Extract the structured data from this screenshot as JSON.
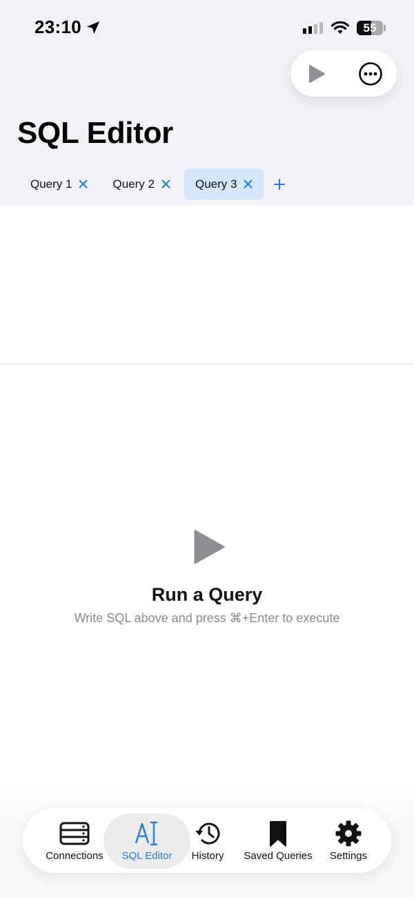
{
  "status_bar": {
    "time": "23:10",
    "battery": "55",
    "icons": [
      "location-arrow-icon",
      "cellular-signal-icon",
      "wifi-icon",
      "battery-icon"
    ]
  },
  "toolbar": {
    "run_icon": "play-icon",
    "more_icon": "ellipsis-circle-icon"
  },
  "header": {
    "title": "SQL Editor"
  },
  "tabs": [
    {
      "label": "Query 1",
      "active": false
    },
    {
      "label": "Query 2",
      "active": false
    },
    {
      "label": "Query 3",
      "active": true
    }
  ],
  "add_tab_icon": "plus-icon",
  "empty_state": {
    "icon": "play-icon",
    "title": "Run a Query",
    "subtitle": "Write SQL above and press ⌘+Enter to execute"
  },
  "tab_bar": {
    "items": [
      {
        "label": "Connections",
        "icon": "server-icon",
        "active": false
      },
      {
        "label": "SQL Editor",
        "icon": "text-cursor-icon",
        "active": true
      },
      {
        "label": "History",
        "icon": "history-clock-icon",
        "active": false
      },
      {
        "label": "Saved Queries",
        "icon": "bookmark-icon",
        "active": false
      },
      {
        "label": "Settings",
        "icon": "gear-icon",
        "active": false
      }
    ]
  },
  "colors": {
    "accent": "#1f7ee0",
    "header_bg": "#f2f2f7",
    "active_tab_bg": "#d3e6fb",
    "secondary_text": "#8a8a8e"
  }
}
